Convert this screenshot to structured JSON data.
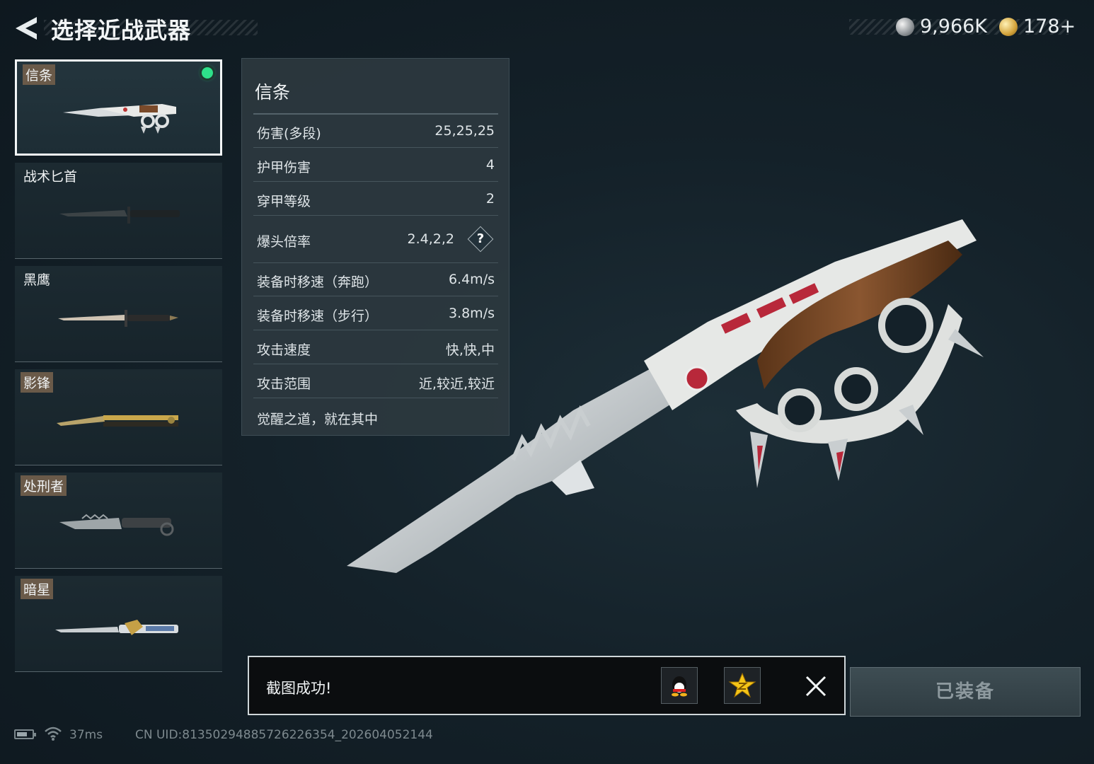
{
  "header": {
    "title": "选择近战武器",
    "back_icon": "chevron-left-icon"
  },
  "currency": {
    "silver": {
      "icon": "silver-coin-icon",
      "amount": "9,966K"
    },
    "gold": {
      "icon": "gold-coin-icon",
      "amount": "178+"
    }
  },
  "weapons": [
    {
      "name": "信条",
      "tagged": true,
      "selected": true,
      "equipped": true
    },
    {
      "name": "战术匕首",
      "tagged": false,
      "selected": false,
      "equipped": false
    },
    {
      "name": "黑鹰",
      "tagged": false,
      "selected": false,
      "equipped": false
    },
    {
      "name": "影锋",
      "tagged": true,
      "selected": false,
      "equipped": false
    },
    {
      "name": "处刑者",
      "tagged": true,
      "selected": false,
      "equipped": false
    },
    {
      "name": "暗星",
      "tagged": true,
      "selected": false,
      "equipped": false
    }
  ],
  "stats": {
    "title": "信条",
    "rows": [
      {
        "name": "伤害(多段)",
        "value": "25,25,25"
      },
      {
        "name": "护甲伤害",
        "value": "4"
      },
      {
        "name": "穿甲等级",
        "value": "2"
      },
      {
        "name": "爆头倍率",
        "value": "2.4,2,2",
        "help": "?"
      },
      {
        "name": "装备时移速（奔跑）",
        "value": "6.4m/s"
      },
      {
        "name": "装备时移速（步行）",
        "value": "3.8m/s"
      },
      {
        "name": "攻击速度",
        "value": "快,快,中"
      },
      {
        "name": "攻击范围",
        "value": "近,较近,较近"
      }
    ],
    "description": "觉醒之道，就在其中"
  },
  "toast": {
    "message": "截图成功!",
    "share_icons": [
      "qq-icon",
      "qzone-icon"
    ],
    "close_icon": "close-icon"
  },
  "equip_button": {
    "label": "已装备"
  },
  "status_bar": {
    "ping": "37ms",
    "uid": "CN UID:8135029488572622635​4_202604052144"
  },
  "colors": {
    "background": "#142129",
    "equipped_dot": "#2ee08a",
    "label_tag": "#6a5a49",
    "panel": "#2c383f"
  }
}
